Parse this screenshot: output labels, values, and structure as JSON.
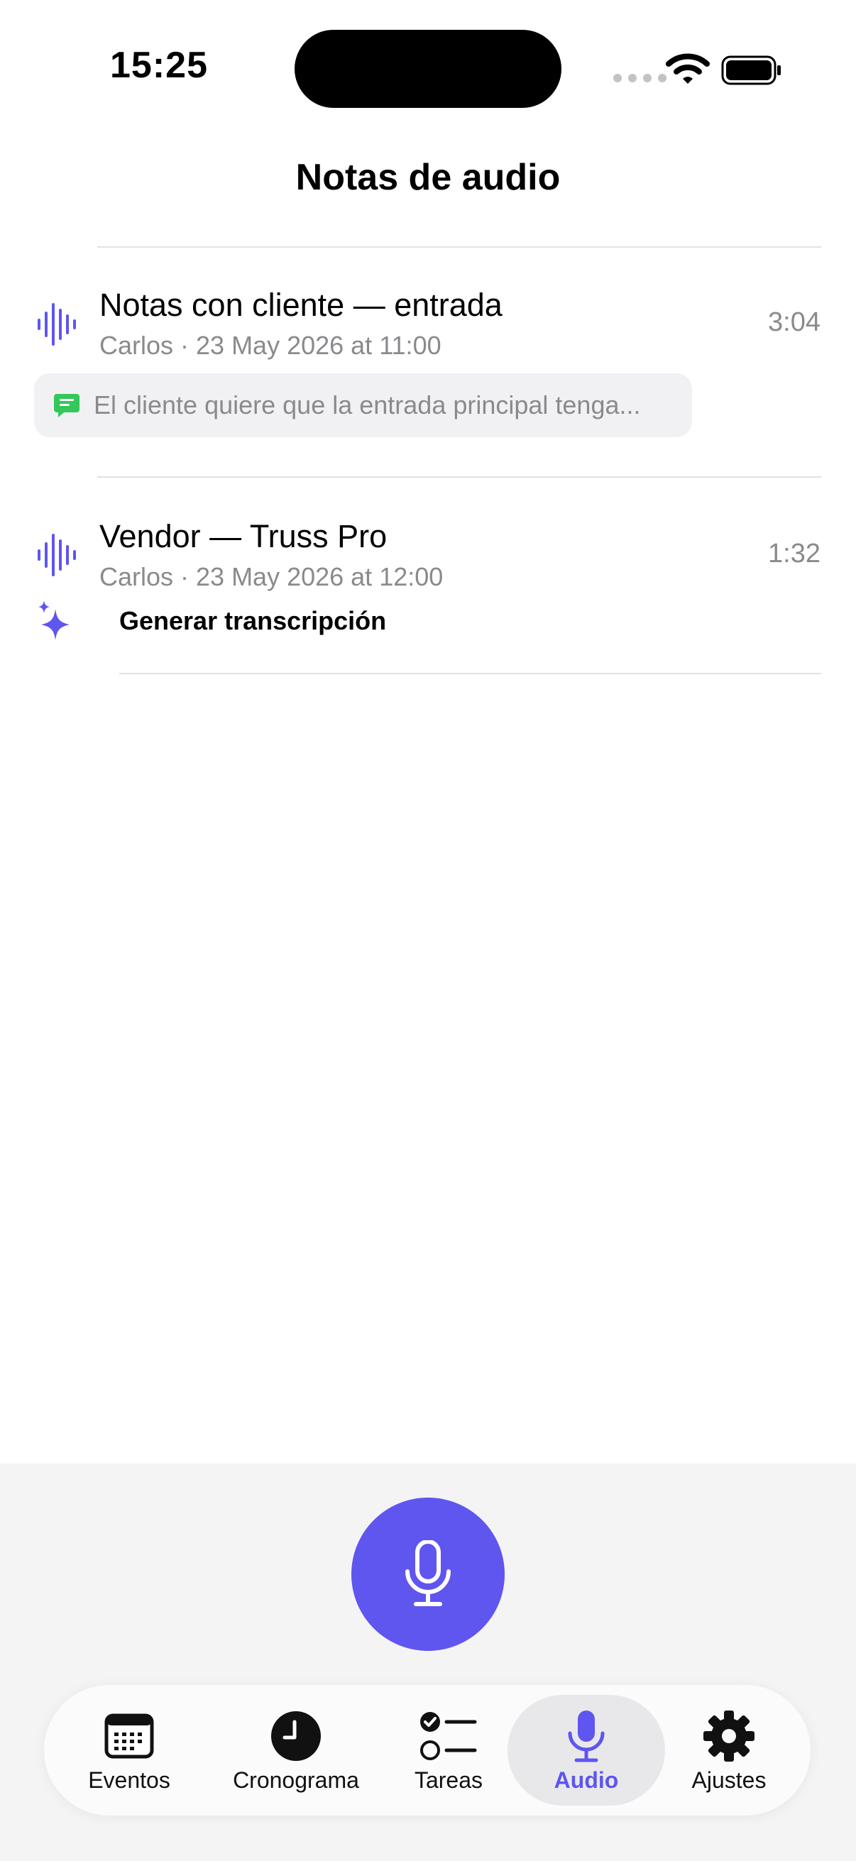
{
  "status_bar": {
    "time": "15:25"
  },
  "header": {
    "title": "Notas de audio"
  },
  "recordings": [
    {
      "title": "Notas con cliente — entrada",
      "meta": "Carlos · 23 May 2026 at 11:00",
      "duration": "3:04",
      "transcript_snippet": "El cliente quiere que la entrada principal tenga..."
    },
    {
      "title": "Vendor — Truss Pro",
      "meta": "Carlos · 23 May 2026 at 12:00",
      "duration": "1:32",
      "action_label": "Generar transcripción"
    }
  ],
  "tabs": [
    {
      "label": "Eventos",
      "icon": "calendar-icon"
    },
    {
      "label": "Cronograma",
      "icon": "clock-icon"
    },
    {
      "label": "Tareas",
      "icon": "checklist-icon"
    },
    {
      "label": "Audio",
      "icon": "microphone-icon",
      "active": true
    },
    {
      "label": "Ajustes",
      "icon": "gear-icon"
    }
  ],
  "colors": {
    "accent": "#5f55ef",
    "secondary_text": "#8a8a8e",
    "snippet_icon": "#34c759",
    "snippet_bg": "#f1f1f4"
  }
}
